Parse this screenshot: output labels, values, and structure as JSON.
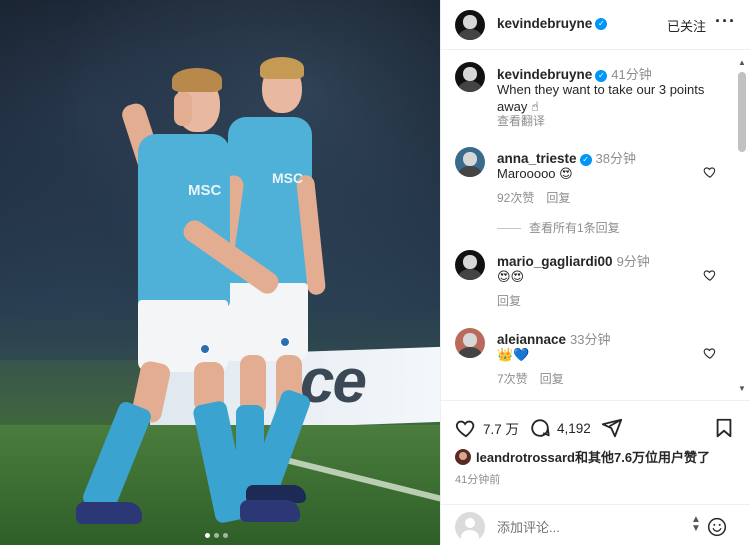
{
  "post": {
    "username": "kevindebruyne",
    "follow_status": "已关注",
    "more_glyph": "···",
    "photo": {
      "board_text": "ce",
      "kit_text_1": "MSC",
      "kit_text_2": "MSC",
      "carousel_dots": 3,
      "active_dot": 0
    }
  },
  "caption": {
    "username": "kevindebruyne",
    "time": "41分钟",
    "text": "When they want to take our 3 points away ☝",
    "translate": "查看翻译"
  },
  "comments": [
    {
      "username": "anna_trieste",
      "verified": true,
      "time": "38分钟",
      "text": "Marooooo 😍",
      "likes": "92次赞",
      "reply": "回复",
      "avatar_color": "#3b6b8c"
    },
    {
      "username": "mario_gagliardi00",
      "verified": false,
      "time": "9分钟",
      "text": "😍😍",
      "likes": "",
      "reply": "回复",
      "avatar_color": "#111111"
    },
    {
      "username": "aleiannace",
      "verified": false,
      "time": "33分钟",
      "text": "👑💙",
      "likes": "7次赞",
      "reply": "回复",
      "avatar_color": "#b96a5a"
    }
  ],
  "thread": {
    "view_replies": "查看所有1条回复"
  },
  "actions": {
    "like_count": "7.7 万",
    "comment_count": "4,192"
  },
  "liked_by": {
    "text": "leandrotrossard和其他7.6万位用户赞了"
  },
  "posted_time": "41分钟前",
  "add_comment": {
    "placeholder": "添加评论..."
  },
  "colors": {
    "accent": "#0095f6",
    "secondary_text": "#8e8e8e",
    "shirt": "#4fb0d8"
  },
  "icons": [
    "heart-icon",
    "comment-icon",
    "share-icon",
    "bookmark-icon",
    "verified-icon",
    "emoji-icon",
    "more-icon"
  ]
}
